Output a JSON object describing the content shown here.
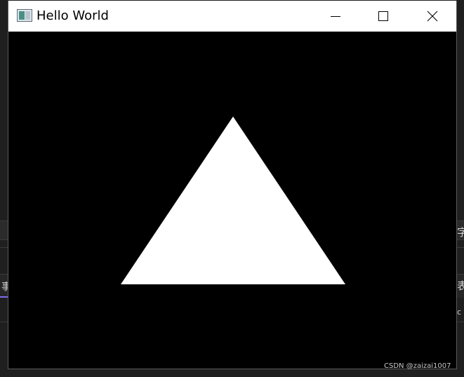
{
  "window": {
    "title": "Hello World",
    "controls": {
      "minimize": "minimize",
      "maximize": "maximize",
      "close": "close"
    }
  },
  "canvas": {
    "background": "#000000",
    "shape": "triangle",
    "fill": "#ffffff"
  },
  "background_fragments": {
    "left_glyph": "事",
    "right_glyph_1": "字",
    "right_glyph_2": "表",
    "right_glyph_3": "c"
  },
  "watermark": "CSDN @zaizai1007"
}
